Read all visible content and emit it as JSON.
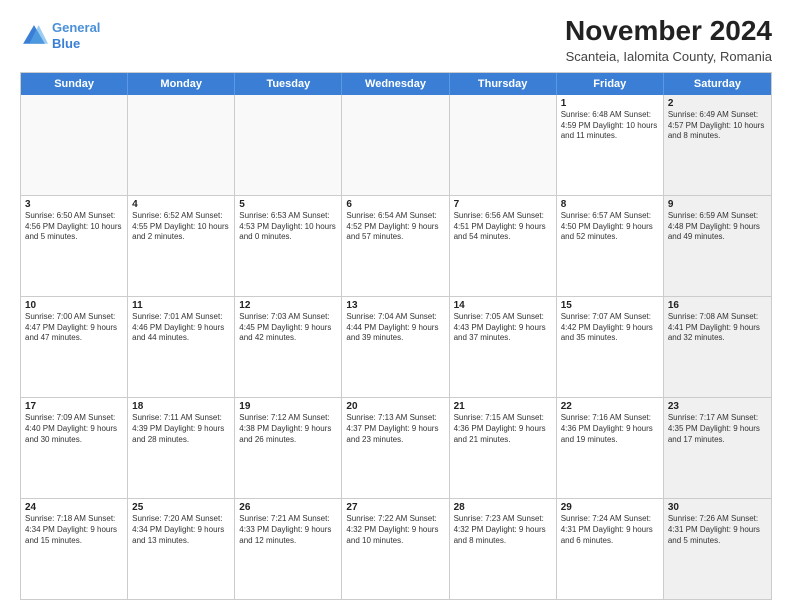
{
  "header": {
    "logo_line1": "General",
    "logo_line2": "Blue",
    "title": "November 2024",
    "subtitle": "Scanteia, Ialomita County, Romania"
  },
  "days_of_week": [
    "Sunday",
    "Monday",
    "Tuesday",
    "Wednesday",
    "Thursday",
    "Friday",
    "Saturday"
  ],
  "weeks": [
    [
      {
        "day": "",
        "info": "",
        "empty": true
      },
      {
        "day": "",
        "info": "",
        "empty": true
      },
      {
        "day": "",
        "info": "",
        "empty": true
      },
      {
        "day": "",
        "info": "",
        "empty": true
      },
      {
        "day": "",
        "info": "",
        "empty": true
      },
      {
        "day": "1",
        "info": "Sunrise: 6:48 AM\nSunset: 4:59 PM\nDaylight: 10 hours\nand 11 minutes.",
        "empty": false,
        "shaded": false
      },
      {
        "day": "2",
        "info": "Sunrise: 6:49 AM\nSunset: 4:57 PM\nDaylight: 10 hours\nand 8 minutes.",
        "empty": false,
        "shaded": true
      }
    ],
    [
      {
        "day": "3",
        "info": "Sunrise: 6:50 AM\nSunset: 4:56 PM\nDaylight: 10 hours\nand 5 minutes.",
        "empty": false,
        "shaded": false
      },
      {
        "day": "4",
        "info": "Sunrise: 6:52 AM\nSunset: 4:55 PM\nDaylight: 10 hours\nand 2 minutes.",
        "empty": false,
        "shaded": false
      },
      {
        "day": "5",
        "info": "Sunrise: 6:53 AM\nSunset: 4:53 PM\nDaylight: 10 hours\nand 0 minutes.",
        "empty": false,
        "shaded": false
      },
      {
        "day": "6",
        "info": "Sunrise: 6:54 AM\nSunset: 4:52 PM\nDaylight: 9 hours\nand 57 minutes.",
        "empty": false,
        "shaded": false
      },
      {
        "day": "7",
        "info": "Sunrise: 6:56 AM\nSunset: 4:51 PM\nDaylight: 9 hours\nand 54 minutes.",
        "empty": false,
        "shaded": false
      },
      {
        "day": "8",
        "info": "Sunrise: 6:57 AM\nSunset: 4:50 PM\nDaylight: 9 hours\nand 52 minutes.",
        "empty": false,
        "shaded": false
      },
      {
        "day": "9",
        "info": "Sunrise: 6:59 AM\nSunset: 4:48 PM\nDaylight: 9 hours\nand 49 minutes.",
        "empty": false,
        "shaded": true
      }
    ],
    [
      {
        "day": "10",
        "info": "Sunrise: 7:00 AM\nSunset: 4:47 PM\nDaylight: 9 hours\nand 47 minutes.",
        "empty": false,
        "shaded": false
      },
      {
        "day": "11",
        "info": "Sunrise: 7:01 AM\nSunset: 4:46 PM\nDaylight: 9 hours\nand 44 minutes.",
        "empty": false,
        "shaded": false
      },
      {
        "day": "12",
        "info": "Sunrise: 7:03 AM\nSunset: 4:45 PM\nDaylight: 9 hours\nand 42 minutes.",
        "empty": false,
        "shaded": false
      },
      {
        "day": "13",
        "info": "Sunrise: 7:04 AM\nSunset: 4:44 PM\nDaylight: 9 hours\nand 39 minutes.",
        "empty": false,
        "shaded": false
      },
      {
        "day": "14",
        "info": "Sunrise: 7:05 AM\nSunset: 4:43 PM\nDaylight: 9 hours\nand 37 minutes.",
        "empty": false,
        "shaded": false
      },
      {
        "day": "15",
        "info": "Sunrise: 7:07 AM\nSunset: 4:42 PM\nDaylight: 9 hours\nand 35 minutes.",
        "empty": false,
        "shaded": false
      },
      {
        "day": "16",
        "info": "Sunrise: 7:08 AM\nSunset: 4:41 PM\nDaylight: 9 hours\nand 32 minutes.",
        "empty": false,
        "shaded": true
      }
    ],
    [
      {
        "day": "17",
        "info": "Sunrise: 7:09 AM\nSunset: 4:40 PM\nDaylight: 9 hours\nand 30 minutes.",
        "empty": false,
        "shaded": false
      },
      {
        "day": "18",
        "info": "Sunrise: 7:11 AM\nSunset: 4:39 PM\nDaylight: 9 hours\nand 28 minutes.",
        "empty": false,
        "shaded": false
      },
      {
        "day": "19",
        "info": "Sunrise: 7:12 AM\nSunset: 4:38 PM\nDaylight: 9 hours\nand 26 minutes.",
        "empty": false,
        "shaded": false
      },
      {
        "day": "20",
        "info": "Sunrise: 7:13 AM\nSunset: 4:37 PM\nDaylight: 9 hours\nand 23 minutes.",
        "empty": false,
        "shaded": false
      },
      {
        "day": "21",
        "info": "Sunrise: 7:15 AM\nSunset: 4:36 PM\nDaylight: 9 hours\nand 21 minutes.",
        "empty": false,
        "shaded": false
      },
      {
        "day": "22",
        "info": "Sunrise: 7:16 AM\nSunset: 4:36 PM\nDaylight: 9 hours\nand 19 minutes.",
        "empty": false,
        "shaded": false
      },
      {
        "day": "23",
        "info": "Sunrise: 7:17 AM\nSunset: 4:35 PM\nDaylight: 9 hours\nand 17 minutes.",
        "empty": false,
        "shaded": true
      }
    ],
    [
      {
        "day": "24",
        "info": "Sunrise: 7:18 AM\nSunset: 4:34 PM\nDaylight: 9 hours\nand 15 minutes.",
        "empty": false,
        "shaded": false
      },
      {
        "day": "25",
        "info": "Sunrise: 7:20 AM\nSunset: 4:34 PM\nDaylight: 9 hours\nand 13 minutes.",
        "empty": false,
        "shaded": false
      },
      {
        "day": "26",
        "info": "Sunrise: 7:21 AM\nSunset: 4:33 PM\nDaylight: 9 hours\nand 12 minutes.",
        "empty": false,
        "shaded": false
      },
      {
        "day": "27",
        "info": "Sunrise: 7:22 AM\nSunset: 4:32 PM\nDaylight: 9 hours\nand 10 minutes.",
        "empty": false,
        "shaded": false
      },
      {
        "day": "28",
        "info": "Sunrise: 7:23 AM\nSunset: 4:32 PM\nDaylight: 9 hours\nand 8 minutes.",
        "empty": false,
        "shaded": false
      },
      {
        "day": "29",
        "info": "Sunrise: 7:24 AM\nSunset: 4:31 PM\nDaylight: 9 hours\nand 6 minutes.",
        "empty": false,
        "shaded": false
      },
      {
        "day": "30",
        "info": "Sunrise: 7:26 AM\nSunset: 4:31 PM\nDaylight: 9 hours\nand 5 minutes.",
        "empty": false,
        "shaded": true
      }
    ]
  ]
}
